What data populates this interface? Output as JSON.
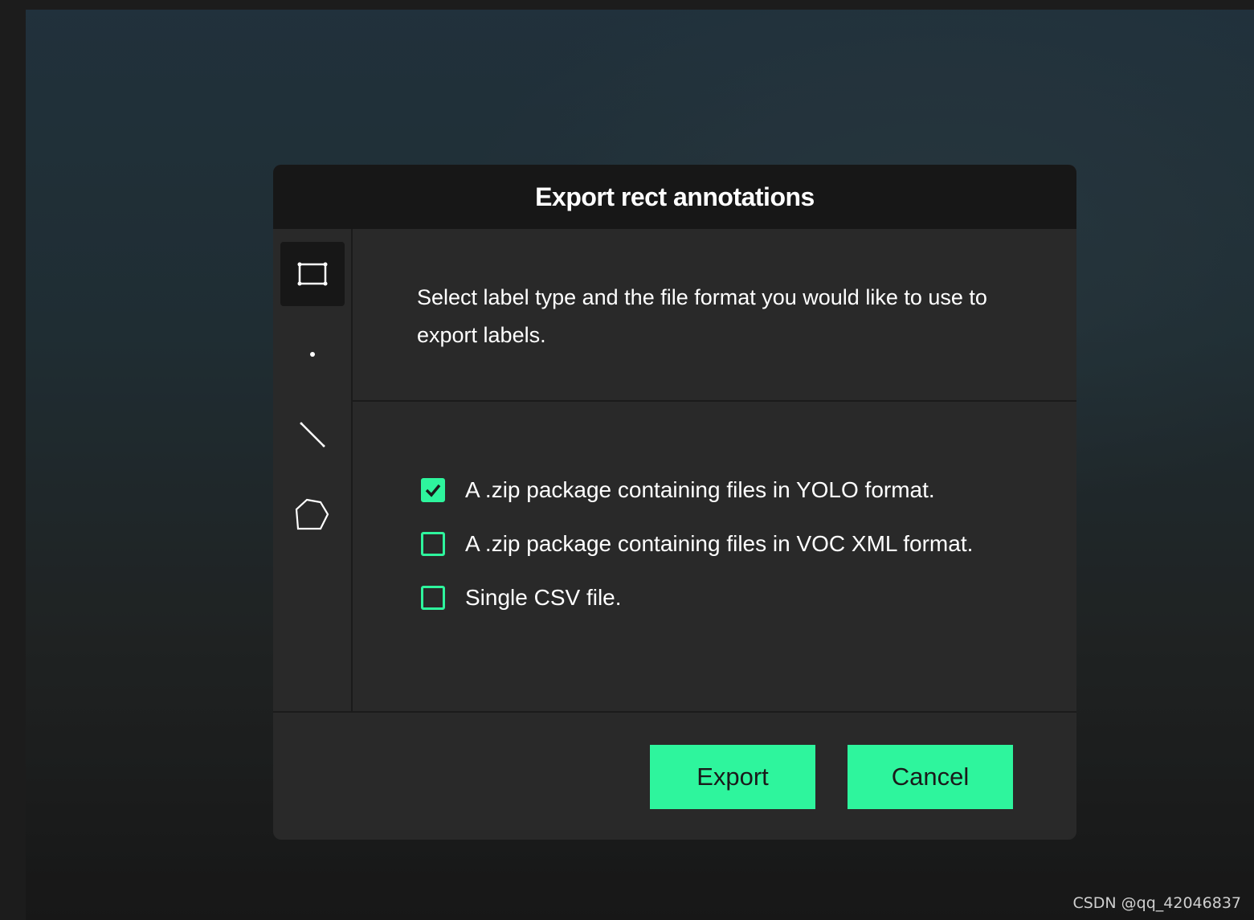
{
  "dialog": {
    "title": "Export rect annotations",
    "instructions": "Select label type and the file format you would like to use to export labels.",
    "label_types": [
      {
        "icon": "rectangle-icon",
        "active": true
      },
      {
        "icon": "point-icon",
        "active": false
      },
      {
        "icon": "line-icon",
        "active": false
      },
      {
        "icon": "polygon-icon",
        "active": false
      }
    ],
    "options": [
      {
        "label": "A .zip package containing files in YOLO format.",
        "checked": true
      },
      {
        "label": "A .zip package containing files in VOC XML format.",
        "checked": false
      },
      {
        "label": "Single CSV file.",
        "checked": false
      }
    ],
    "export_label": "Export",
    "cancel_label": "Cancel"
  },
  "watermark": "CSDN @qq_42046837",
  "colors": {
    "accent": "#2ef59d",
    "dialog_bg": "#292929",
    "header_bg": "#171717"
  }
}
